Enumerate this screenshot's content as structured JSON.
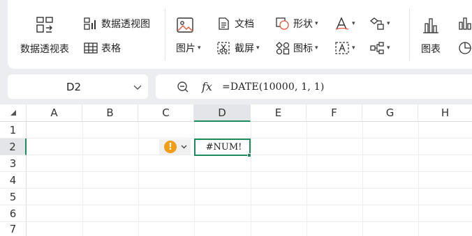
{
  "ribbon": {
    "pivot_chart_label": "数据透视图",
    "pivot_table_label": "数据透视表",
    "table_label": "表格",
    "picture_label": "图片",
    "text_label": "文档",
    "screenshot_label": "截屏",
    "shape_label": "形状",
    "icon_label": "图标",
    "chart_label": "图表"
  },
  "name_box": {
    "value": "D2"
  },
  "formula_bar": {
    "fx": "fx",
    "formula": "=DATE(10000, 1, 1)"
  },
  "columns": [
    "A",
    "B",
    "C",
    "D",
    "E",
    "F",
    "G",
    "H"
  ],
  "rows": [
    "1",
    "2",
    "3",
    "4",
    "5",
    "6",
    "7"
  ],
  "selected_cell": {
    "ref": "D2",
    "value": "#NUM!"
  },
  "error_indicator": {
    "symbol": "!",
    "color": "#f29d17"
  },
  "accent_color": "#1f8a5b"
}
